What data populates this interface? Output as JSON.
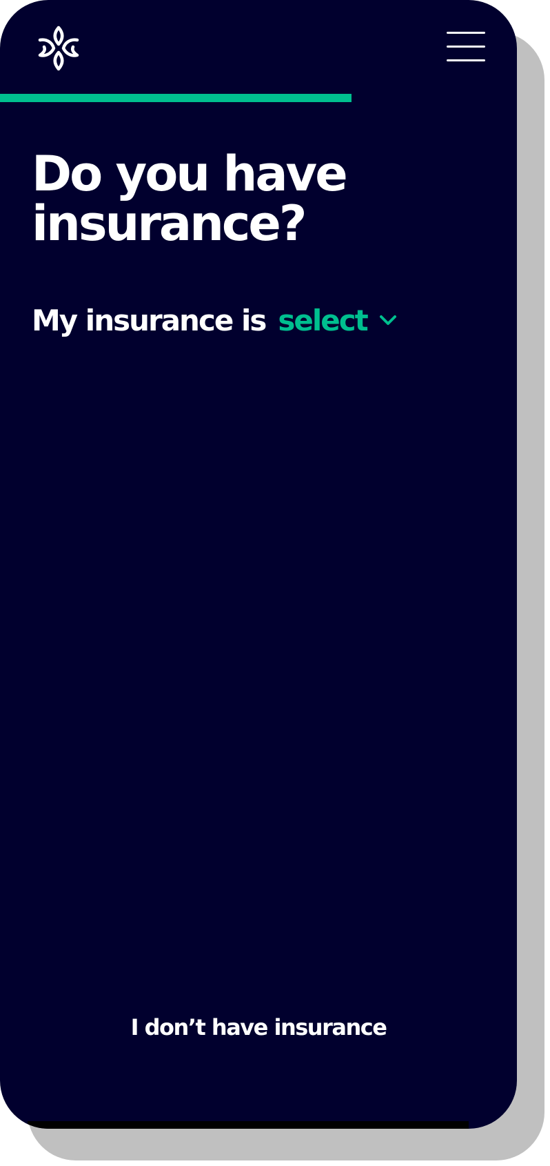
{
  "header": {
    "logo_icon": "lotus-logo-icon",
    "menu_icon": "hamburger-menu-icon"
  },
  "progress": {
    "fraction": 0.68,
    "color": "#00bf8f"
  },
  "question": {
    "title": "Do you have insurance?"
  },
  "insurance_select": {
    "prefix": "My insurance is",
    "value": "select",
    "chevron_icon": "chevron-down-icon"
  },
  "footer": {
    "no_insurance_label": "I don’t have insurance"
  },
  "colors": {
    "background": "#01002e",
    "accent": "#00bf8f",
    "text": "#ffffff"
  }
}
